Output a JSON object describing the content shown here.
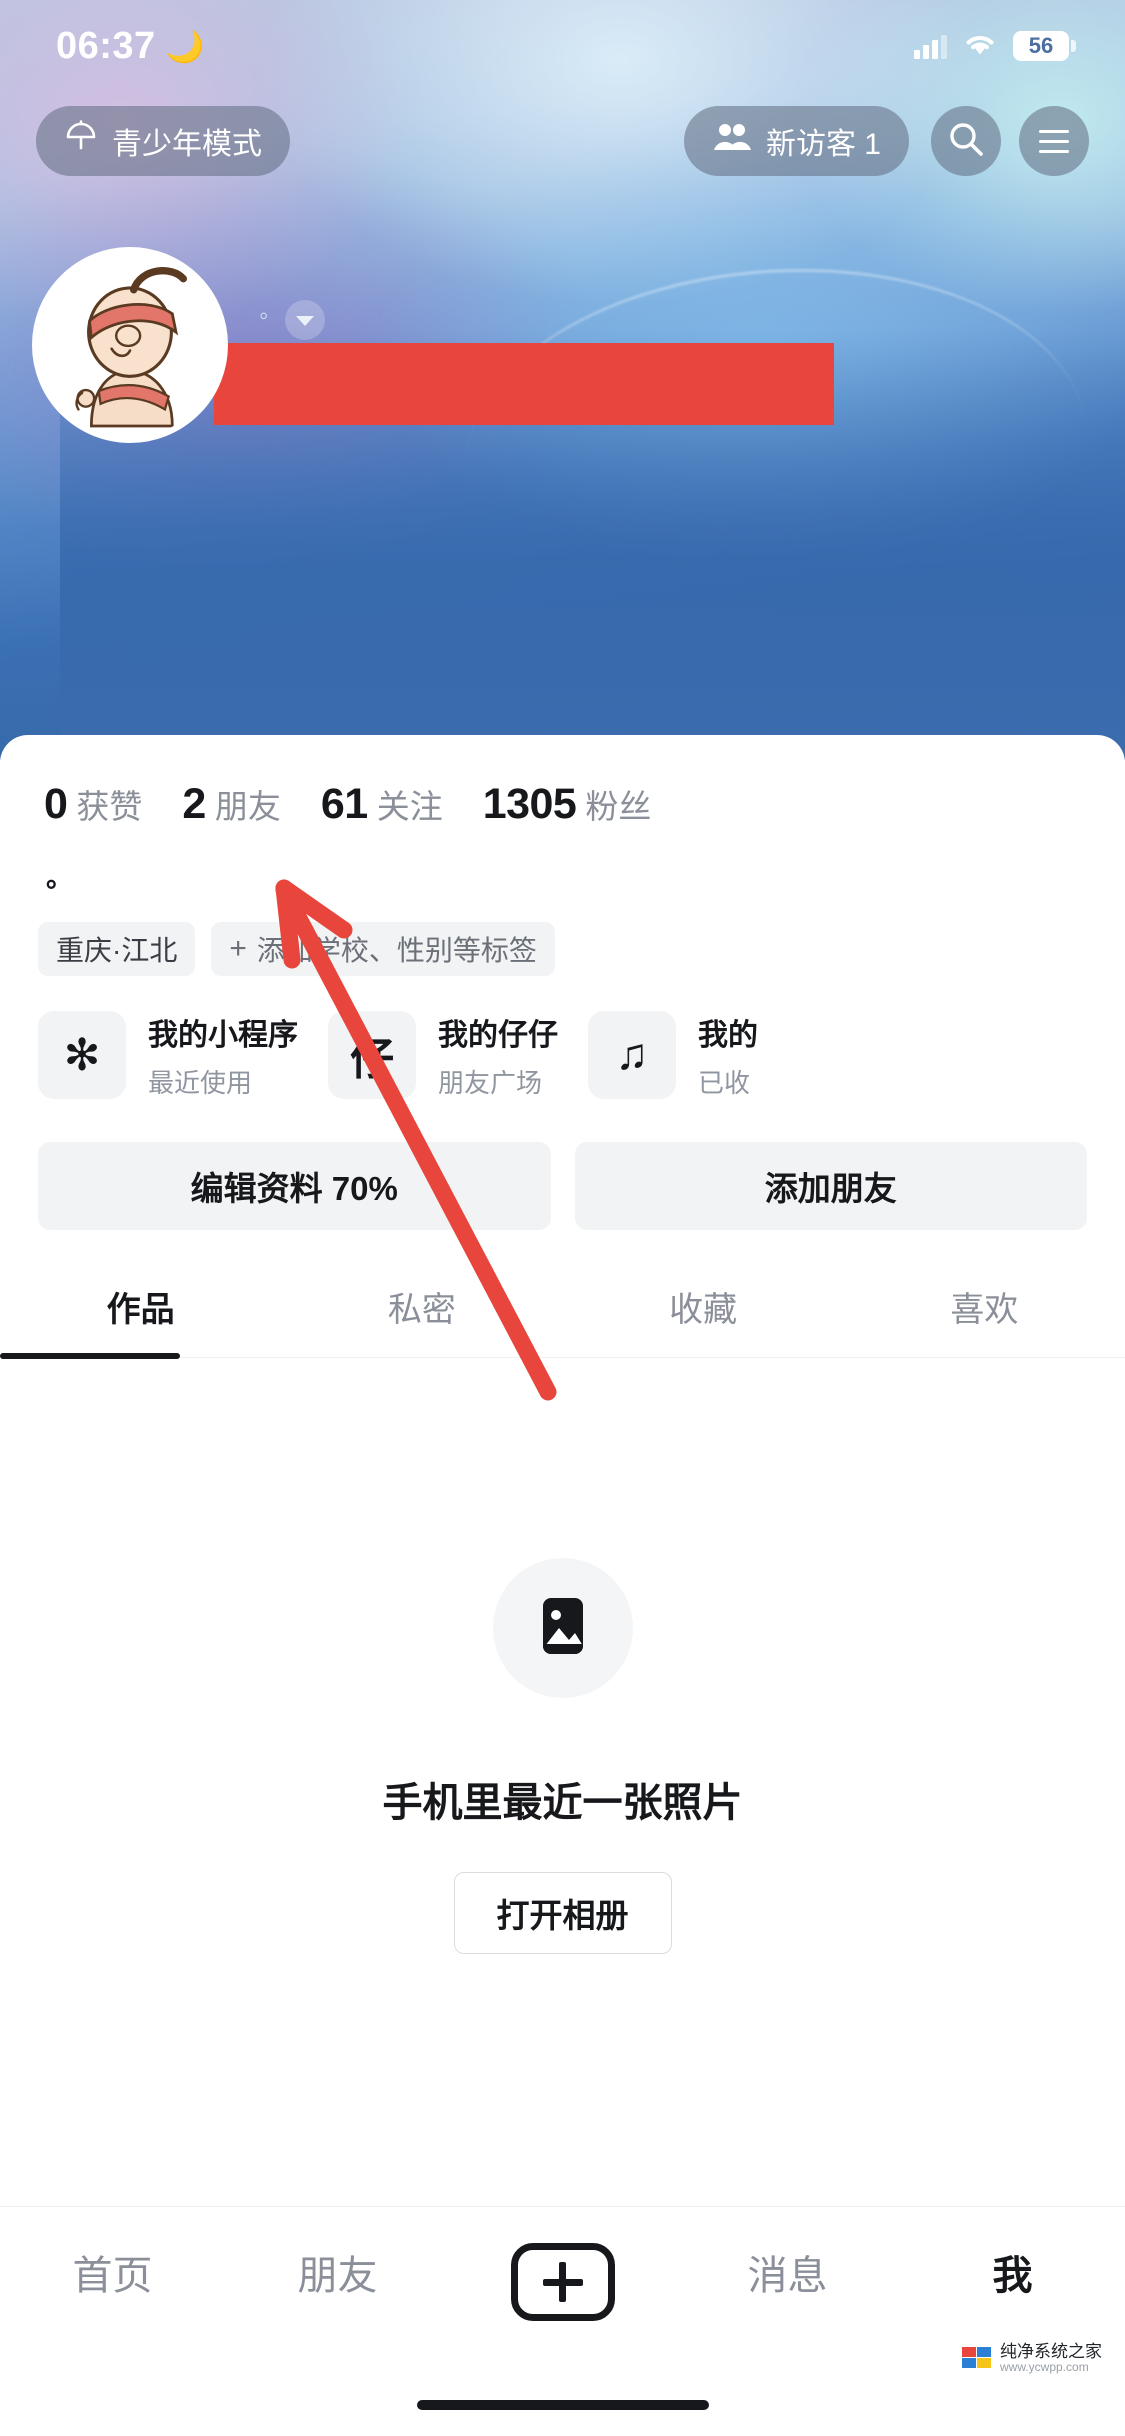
{
  "status_bar": {
    "time": "06:37",
    "moon_icon": "moon-icon",
    "signal_icon": "cellular-signal-icon",
    "wifi_icon": "wifi-icon",
    "battery_level": "56"
  },
  "header": {
    "teen_mode": {
      "label": "青少年模式",
      "icon": "umbrella-icon"
    },
    "visitors": {
      "label": "新访客 1",
      "icon": "people-icon"
    },
    "search_icon": "search-icon",
    "menu_icon": "hamburger-menu-icon"
  },
  "profile": {
    "avatar_alt": "avatar",
    "name_redacted": "",
    "name_dropdown_icon": "chevron-down-icon",
    "bio": "。",
    "stats": [
      {
        "value": "0",
        "label": "获赞"
      },
      {
        "value": "2",
        "label": "朋友"
      },
      {
        "value": "61",
        "label": "关注"
      },
      {
        "value": "1305",
        "label": "粉丝"
      }
    ],
    "tags": [
      {
        "text": "重庆·江北",
        "has_plus": false
      },
      {
        "text": "添加学校、性别等标签",
        "has_plus": true
      }
    ]
  },
  "feature_cards": [
    {
      "icon_glyph": "✻",
      "icon_name": "mini-program-icon",
      "title": "我的小程序",
      "subtitle": "最近使用"
    },
    {
      "icon_glyph": "仔",
      "icon_name": "zaizai-icon",
      "title": "我的仔仔",
      "subtitle": "朋友广场"
    },
    {
      "icon_glyph": "♫",
      "icon_name": "music-note-icon",
      "title": "我的",
      "subtitle": "已收"
    }
  ],
  "actions": [
    {
      "label": "编辑资料 70%",
      "name": "edit-profile-button"
    },
    {
      "label": "添加朋友",
      "name": "add-friend-button"
    }
  ],
  "tabs": [
    {
      "label": "作品",
      "active": true
    },
    {
      "label": "私密",
      "active": false
    },
    {
      "label": "收藏",
      "active": false
    },
    {
      "label": "喜欢",
      "active": false
    }
  ],
  "empty_state": {
    "icon": "image-placeholder-icon",
    "title": "手机里最近一张照片",
    "button_label": "打开相册"
  },
  "bottom_nav": [
    {
      "label": "首页",
      "active": false
    },
    {
      "label": "朋友",
      "active": false
    },
    {
      "label": "",
      "active": false,
      "icon": "plus-create-icon"
    },
    {
      "label": "消息",
      "active": false
    },
    {
      "label": "我",
      "active": true
    }
  ],
  "annotation": {
    "type": "arrow",
    "color": "#e8453c",
    "points_to": "编辑资料 70%"
  },
  "watermark": {
    "line1": "纯净系统之家",
    "line2": "www.ycwpp.com"
  },
  "colors": {
    "accent_red": "#e8453c",
    "text_primary": "#16181c",
    "text_secondary": "#8a8f99",
    "chip_bg": "#f2f3f5"
  }
}
